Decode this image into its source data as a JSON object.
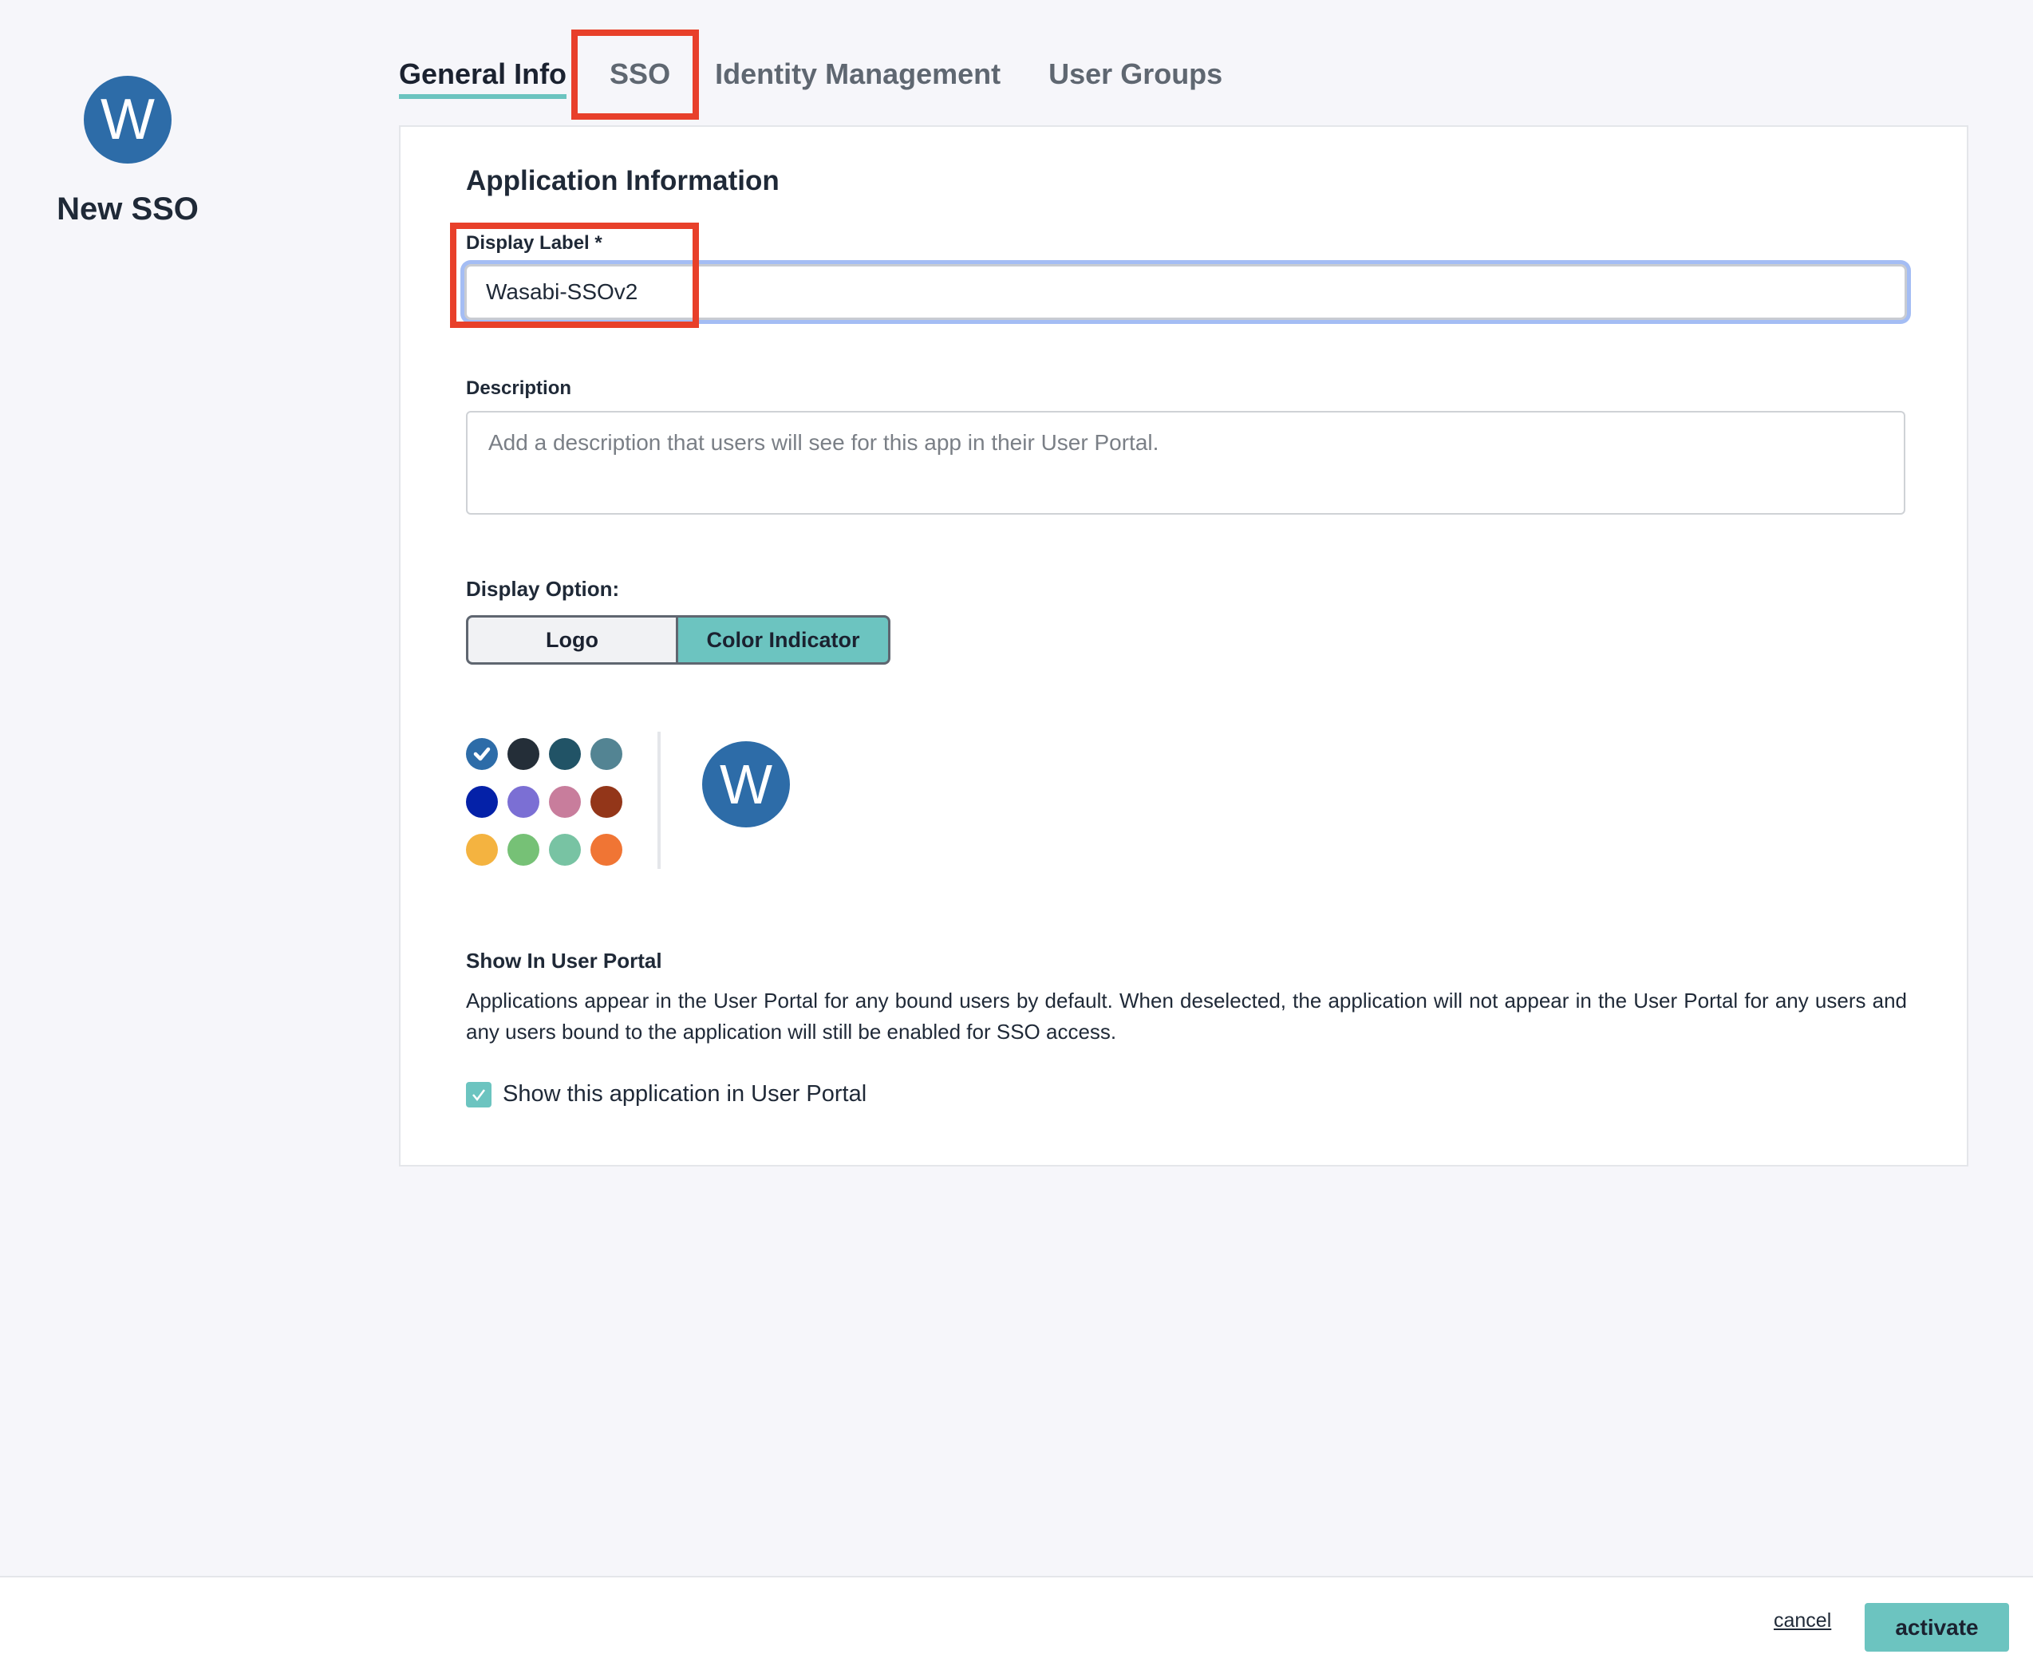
{
  "app": {
    "avatar_letter": "W",
    "name": "New SSO"
  },
  "tabs": [
    {
      "label": "General Info",
      "active": true
    },
    {
      "label": "SSO",
      "active": false
    },
    {
      "label": "Identity Management",
      "active": false
    },
    {
      "label": "User Groups",
      "active": false
    }
  ],
  "form": {
    "section_title": "Application Information",
    "display_label": {
      "label": "Display Label *",
      "value": "Wasabi-SSOv2"
    },
    "description": {
      "label": "Description",
      "value": "",
      "placeholder": "Add a description that users will see for this app in their User Portal."
    },
    "display_option": {
      "label": "Display Option:",
      "options": [
        "Logo",
        "Color Indicator"
      ],
      "selected": "Color Indicator"
    },
    "colors": {
      "swatches": [
        "#2d6ca8",
        "#242e38",
        "#215366",
        "#538493",
        "#0421a8",
        "#7b6fd4",
        "#c87d9c",
        "#933619",
        "#f4b340",
        "#76c176",
        "#78c3a3",
        "#f07534"
      ],
      "selected": "#2d6ca8"
    },
    "preview_letter": "W",
    "show_in_portal": {
      "title": "Show In User Portal",
      "description": "Applications appear in the User Portal for any bound users by default. When deselected, the application will not appear in the User Portal for any users and any users bound to the application will still be enabled for SSO access.",
      "checkbox_label": "Show this application in User Portal",
      "checked": true
    }
  },
  "footer": {
    "cancel_label": "cancel",
    "activate_label": "activate"
  },
  "colors": {
    "accent": "#6cc4c0",
    "annotation": "#e8402a",
    "focus_ring": "#a4bdf4"
  }
}
